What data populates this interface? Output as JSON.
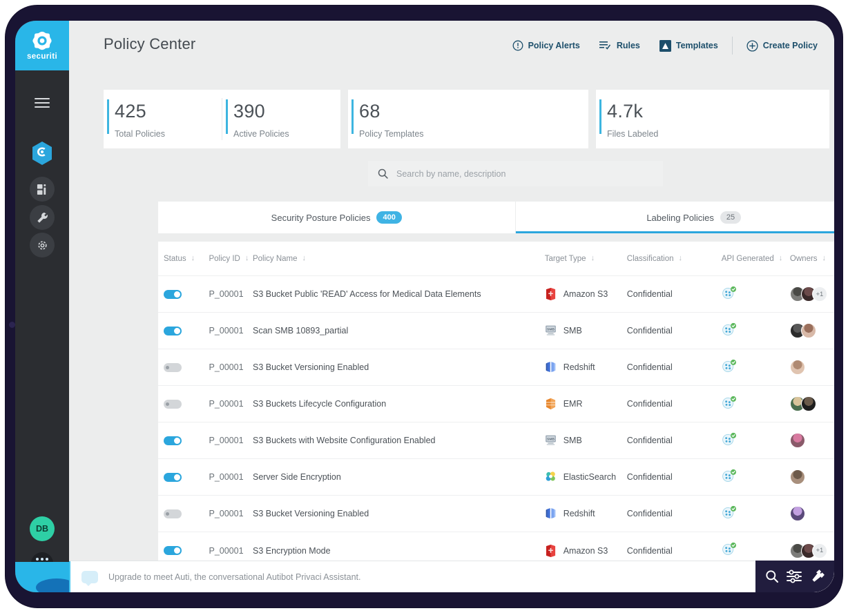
{
  "brand": {
    "name": "securiti",
    "accent": "#29b6e8"
  },
  "sidebar": {
    "menu_icon": "hamburger-icon",
    "items": [
      {
        "name": "hexagon-home-icon",
        "active": true
      },
      {
        "name": "dashboard-icon",
        "active": false
      },
      {
        "name": "wrench-icon",
        "active": false
      },
      {
        "name": "settings-gear-icon",
        "active": false
      }
    ],
    "user_initials": "DB",
    "apps_icon": "apps-grid-icon"
  },
  "header": {
    "title": "Policy Center",
    "nav": [
      {
        "label": "Policy Alerts",
        "icon": "alert-circle-icon"
      },
      {
        "label": "Rules",
        "icon": "rules-list-icon"
      },
      {
        "label": "Templates",
        "icon": "templates-icon"
      },
      {
        "label": "Create Policy",
        "icon": "plus-circle-icon"
      }
    ]
  },
  "stats": [
    {
      "value": "425",
      "label": "Total Policies"
    },
    {
      "value": "390",
      "label": "Active Policies"
    },
    {
      "value": "68",
      "label": "Policy Templates"
    },
    {
      "value": "4.7k",
      "label": "Files Labeled"
    }
  ],
  "search": {
    "placeholder": "Search by name, description",
    "value": "",
    "icon": "search-icon"
  },
  "tabs": [
    {
      "label": "Security Posture Policies",
      "count": "400",
      "active": false,
      "badge_style": "blue"
    },
    {
      "label": "Labeling Policies",
      "count": "25",
      "active": true,
      "badge_style": "muted"
    }
  ],
  "table": {
    "export_icon": "export-file-icon",
    "columns": [
      {
        "key": "status",
        "label": "Status"
      },
      {
        "key": "policy_id",
        "label": "Policy ID"
      },
      {
        "key": "policy_name",
        "label": "Policy Name"
      },
      {
        "key": "target_type",
        "label": "Target Type"
      },
      {
        "key": "classification",
        "label": "Classification"
      },
      {
        "key": "api_generated",
        "label": "API Generated"
      },
      {
        "key": "owners",
        "label": "Owners"
      }
    ],
    "rows": [
      {
        "status": "on",
        "policy_id": "P_00001",
        "policy_name": "S3 Bucket Public 'READ' Access for Medical Data Elements",
        "target_type": "Amazon S3",
        "target_icon": "amazon-s3-icon",
        "classification": "Confidential",
        "api_generated": "yes",
        "owners": 2,
        "owners_more": "+1"
      },
      {
        "status": "on",
        "policy_id": "P_00001",
        "policy_name": "Scan SMB 10893_partial",
        "target_type": "SMB",
        "target_icon": "smb-icon",
        "classification": "Confidential",
        "api_generated": "yes",
        "owners": 2,
        "owners_more": ""
      },
      {
        "status": "off",
        "policy_id": "P_00001",
        "policy_name": "S3 Bucket Versioning Enabled",
        "target_type": "Redshift",
        "target_icon": "redshift-icon",
        "classification": "Confidential",
        "api_generated": "yes",
        "owners": 1,
        "owners_more": ""
      },
      {
        "status": "off",
        "policy_id": "P_00001",
        "policy_name": "S3 Buckets Lifecycle Configuration",
        "target_type": "EMR",
        "target_icon": "emr-icon",
        "classification": "Confidential",
        "api_generated": "yes",
        "owners": 2,
        "owners_more": ""
      },
      {
        "status": "on",
        "policy_id": "P_00001",
        "policy_name": "S3 Buckets with Website Configuration Enabled",
        "target_type": "SMB",
        "target_icon": "smb-icon",
        "classification": "Confidential",
        "api_generated": "yes",
        "owners": 1,
        "owners_more": ""
      },
      {
        "status": "on",
        "policy_id": "P_00001",
        "policy_name": "Server Side Encryption",
        "target_type": "ElasticSearch",
        "target_icon": "elasticsearch-icon",
        "classification": "Confidential",
        "api_generated": "yes",
        "owners": 1,
        "owners_more": ""
      },
      {
        "status": "off",
        "policy_id": "P_00001",
        "policy_name": "S3 Bucket Versioning Enabled",
        "target_type": "Redshift",
        "target_icon": "redshift-icon",
        "classification": "Confidential",
        "api_generated": "yes",
        "owners": 1,
        "owners_more": ""
      },
      {
        "status": "on",
        "policy_id": "P_00001",
        "policy_name": "S3 Encryption Mode",
        "target_type": "Amazon S3",
        "target_icon": "amazon-s3-icon",
        "classification": "Confidential",
        "api_generated": "yes",
        "owners": 2,
        "owners_more": "+1"
      }
    ]
  },
  "bottom": {
    "message": "Upgrade to meet Auti, the conversational Autibot Privaci Assistant.",
    "tools": [
      {
        "icon": "search-icon"
      },
      {
        "icon": "sliders-icon"
      },
      {
        "icon": "hammer-icon"
      }
    ]
  }
}
